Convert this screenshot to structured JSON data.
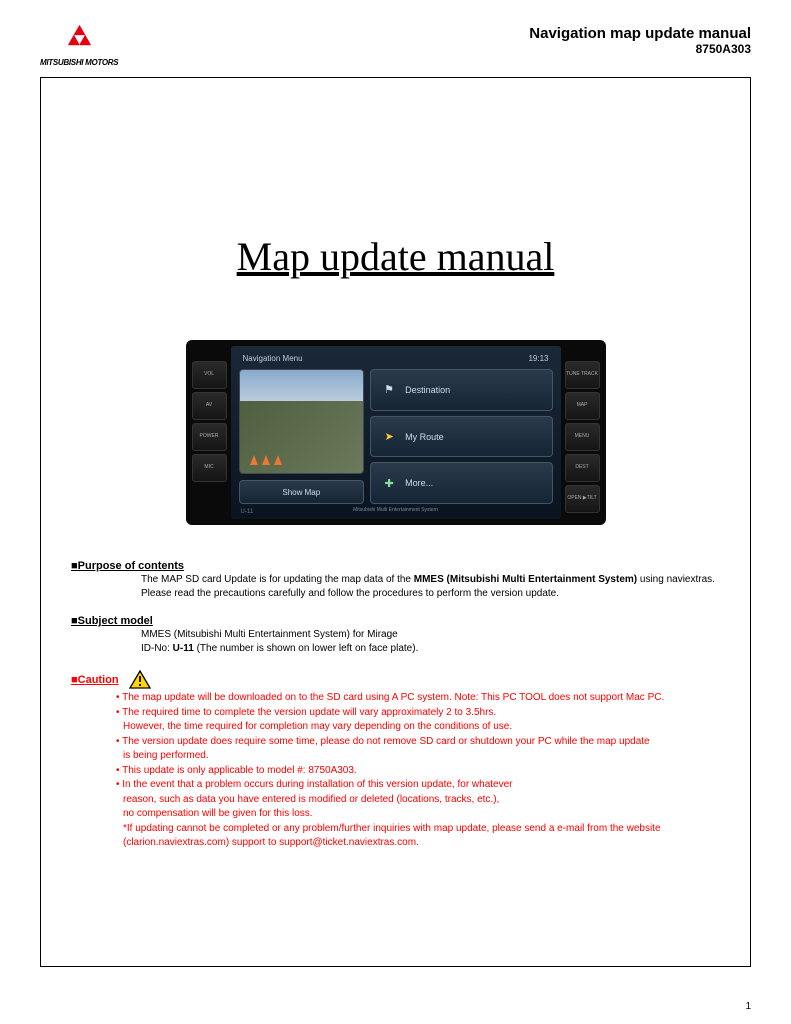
{
  "header": {
    "brand": "MITSUBISHI MOTORS",
    "title": "Navigation map update manual",
    "code": "8750A303"
  },
  "main_title": "Map update manual",
  "device": {
    "left_buttons": [
      "VOL",
      "AV",
      "POWER",
      "MIC"
    ],
    "right_buttons": [
      "TUNE TRACK",
      "MAP",
      "MENU",
      "DEST",
      "OPEN ▶TILT"
    ],
    "screen_title": "Navigation Menu",
    "clock": "19:13",
    "show_map": "Show Map",
    "menu": [
      {
        "icon": "⚑",
        "label": "Destination"
      },
      {
        "icon": "➤",
        "label": "My Route"
      },
      {
        "icon": "✚",
        "label": "More..."
      }
    ],
    "footer_brand": "Mitsubishi Multi Entertainment System",
    "id_corner": "U-11"
  },
  "sections": {
    "purpose": {
      "heading": "Purpose of contents",
      "line1a": "The MAP SD card Update is for updating the map data of the ",
      "line1b": "MMES (Mitsubishi Multi Entertainment System)",
      "line1c": " using naviextras.",
      "line2": "Please read the precautions carefully and follow the procedures to perform the version update."
    },
    "subject": {
      "heading": "Subject model",
      "line1": "MMES (Mitsubishi Multi Entertainment System) for Mirage",
      "line2a": "ID-No: ",
      "line2b": "U-11",
      "line2c": " (The number is shown on lower left on face plate)."
    },
    "caution": {
      "heading": "Caution",
      "lines": [
        "• The map update will be downloaded on to the SD card using A PC system. Note: This PC TOOL does not support Mac PC.",
        "• The required time to complete the version update will vary approximately 2 to 3.5hrs.",
        "  However, the time required for completion may vary depending on the conditions of use.",
        "• The version update does require some time, please do not remove SD card or shutdown your PC while the map update",
        "  is being performed.",
        "• This update is only applicable to model #: 8750A303.",
        "• In the event that a problem occurs during installation of this version update, for whatever",
        "  reason, such as data you have entered is modified or deleted (locations, tracks, etc.),",
        "  no compensation will be given for this loss.",
        "  *If updating cannot be completed or any problem/further inquiries with map update, please send a e-mail from the website",
        "  (clarion.naviextras.com) support to support@ticket.naviextras.com."
      ]
    }
  },
  "page_number": "1"
}
